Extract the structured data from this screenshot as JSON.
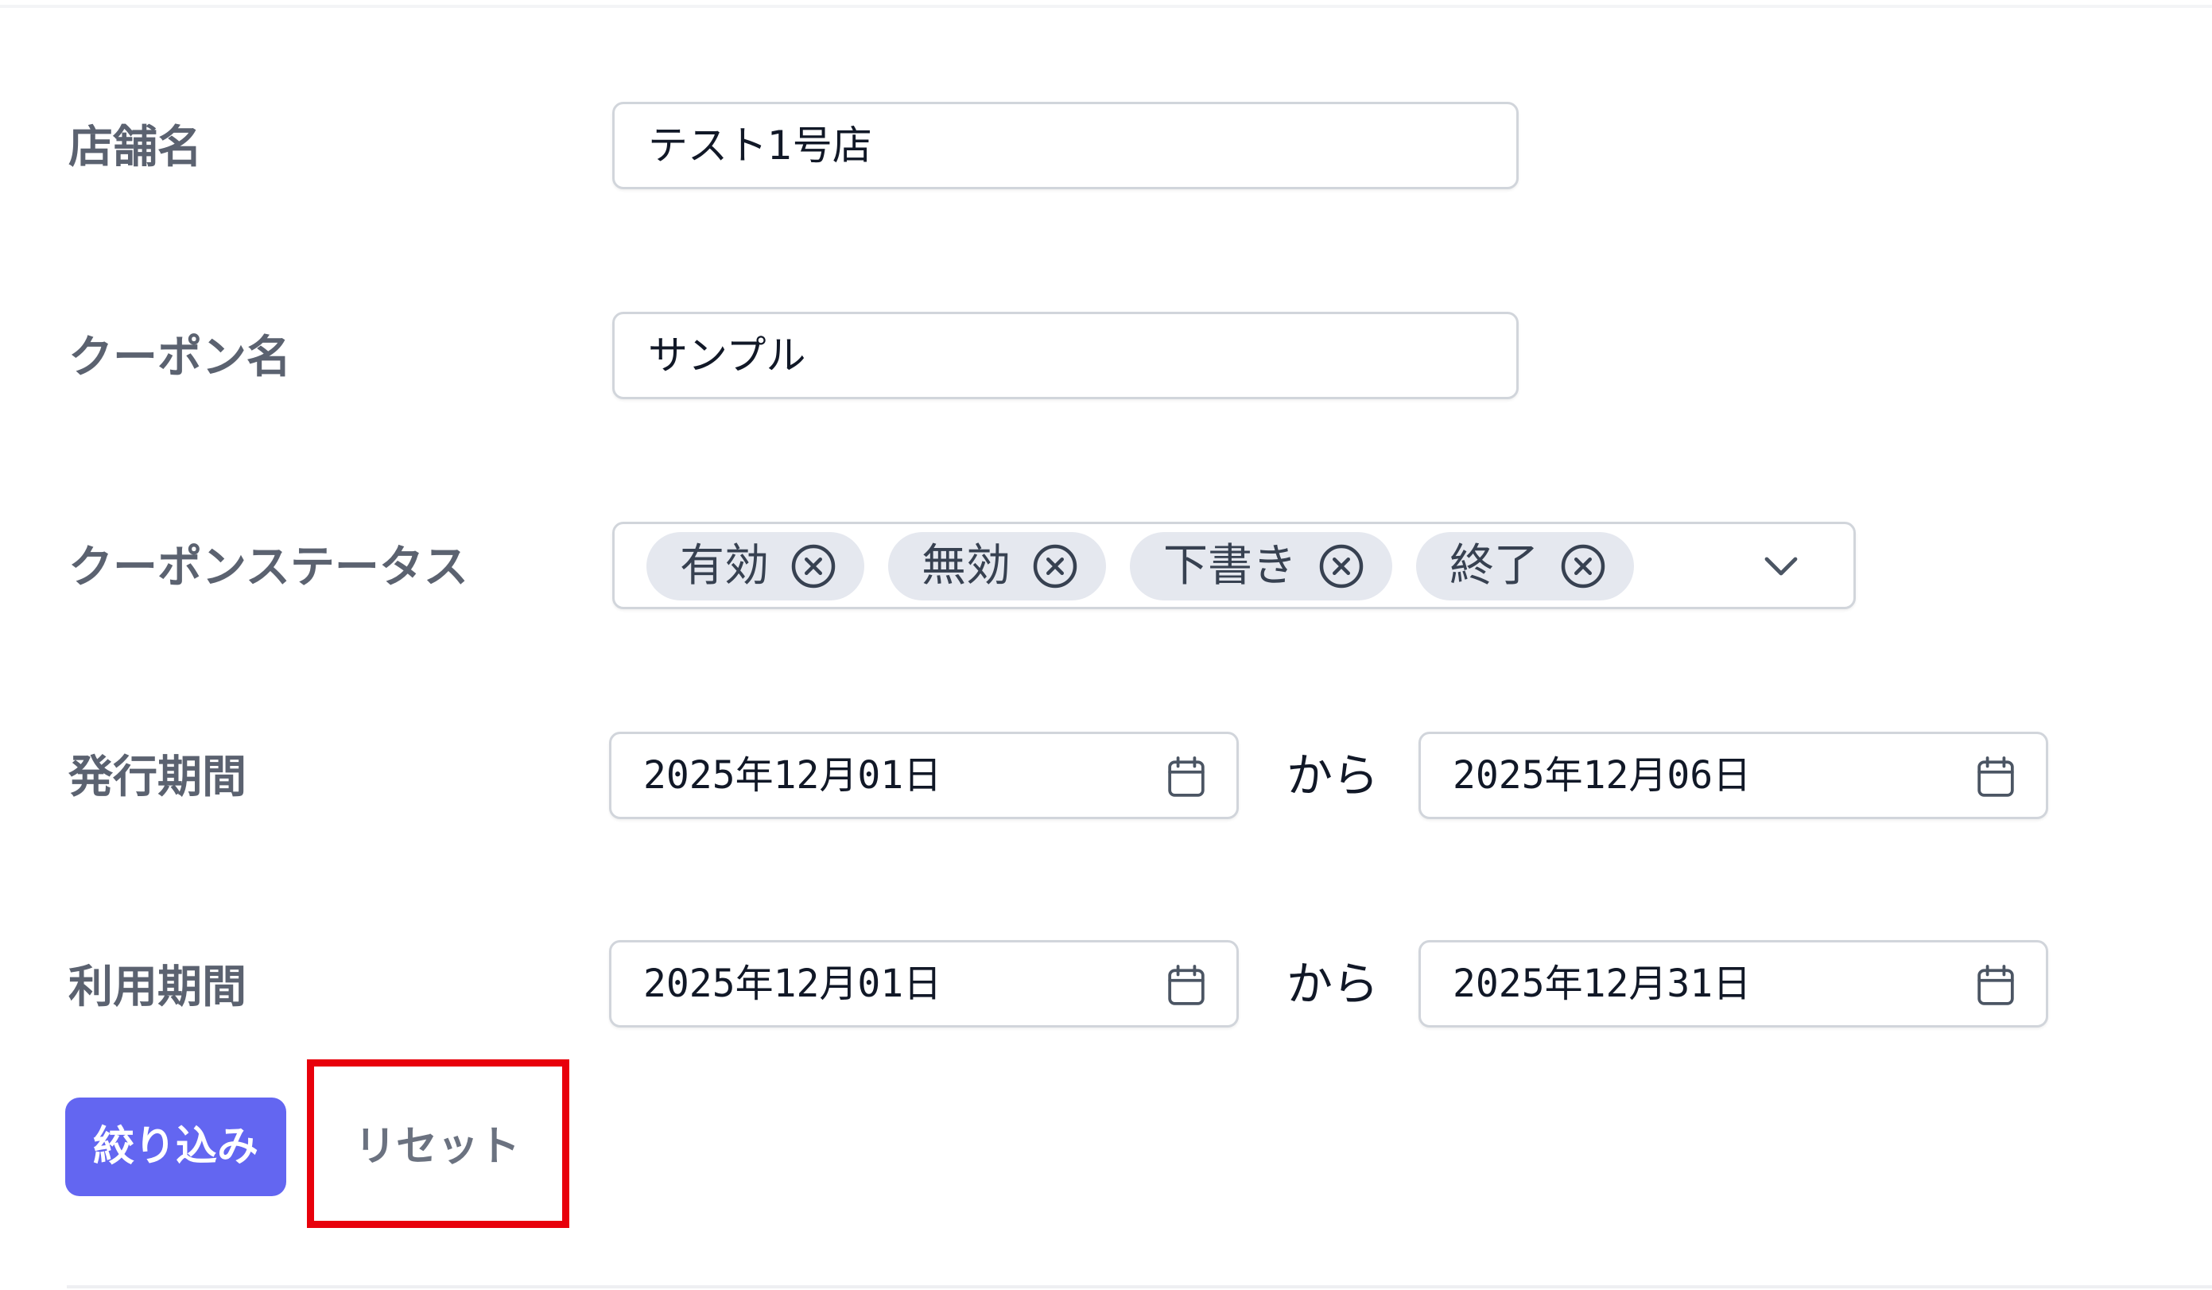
{
  "form": {
    "store_name": {
      "label": "店舗名",
      "value": "テスト1号店"
    },
    "coupon_name": {
      "label": "クーポン名",
      "value": "サンプル"
    },
    "coupon_status": {
      "label": "クーポンステータス",
      "selected": [
        "有効",
        "無効",
        "下書き",
        "終了"
      ],
      "dropdown_icon": "chevron-down-icon",
      "remove_icon": "circle-x-icon"
    },
    "issue_period": {
      "label": "発行期間",
      "from": "2025年12月01日",
      "separator": "から",
      "to": "2025年12月06日",
      "icon": "calendar-icon"
    },
    "usage_period": {
      "label": "利用期間",
      "from": "2025年12月01日",
      "separator": "から",
      "to": "2025年12月31日",
      "icon": "calendar-icon"
    }
  },
  "actions": {
    "filter_label": "絞り込み",
    "reset_label": "リセット"
  },
  "colors": {
    "primary": "#6366f1",
    "chip_bg": "#e5e8ef",
    "label_text": "#5b6270",
    "border": "#d1d5db",
    "highlight": "#e8000b"
  }
}
